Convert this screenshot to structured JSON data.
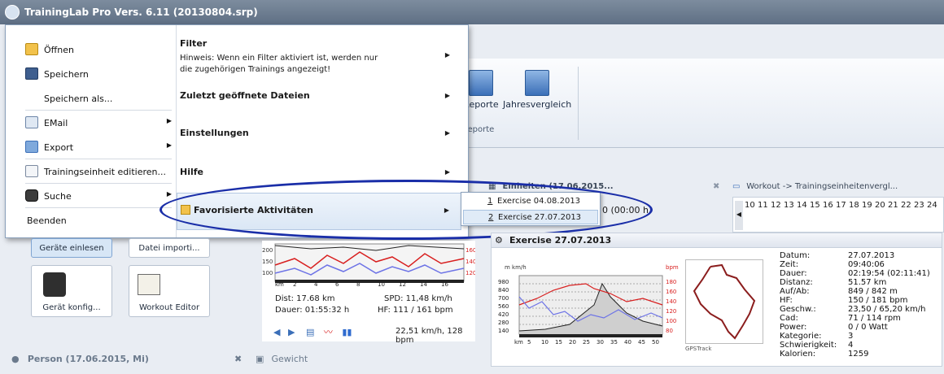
{
  "window": {
    "title": "TrainingLab Pro Vers. 6.11 (20130804.srp)"
  },
  "ribbon": {
    "buttons": [
      {
        "label": "Reporte",
        "icon": "report-icon"
      },
      {
        "label": "Jahresvergleich",
        "icon": "year-compare-icon"
      }
    ],
    "group_label": "Reporte"
  },
  "app_menu": {
    "left_items": [
      {
        "label": "Öffnen",
        "icon": "folder-open-icon",
        "has_submenu": false
      },
      {
        "label": "Speichern",
        "icon": "save-icon",
        "has_submenu": false
      },
      {
        "label": "Speichern als...",
        "icon": "",
        "has_submenu": false
      },
      {
        "label": "EMail",
        "icon": "email-icon",
        "has_submenu": true
      },
      {
        "label": "Export",
        "icon": "export-icon",
        "has_submenu": true
      },
      {
        "label": "Trainingseinheit editieren...",
        "icon": "calendar-icon",
        "has_submenu": false
      },
      {
        "label": "Suche",
        "icon": "binoculars-icon",
        "has_submenu": true
      },
      {
        "label": "Beenden",
        "icon": "",
        "has_submenu": false
      }
    ],
    "right_items": {
      "filter": {
        "title": "Filter",
        "hint": "Hinweis: Wenn ein Filter aktiviert ist, werden nur die zugehörigen Trainings angezeigt!"
      },
      "recent": {
        "title": "Zuletzt geöffnete Dateien"
      },
      "settings": {
        "title": "Einstellungen"
      },
      "help": {
        "title": "Hilfe"
      },
      "favorites": {
        "title": "Favorisierte Aktivitäten"
      }
    },
    "favorites_submenu": [
      {
        "key": "1",
        "label": "Exercise 04.08.2013"
      },
      {
        "key": "2",
        "label": "Exercise 27.07.2013"
      }
    ]
  },
  "background": {
    "info_header": "Einheiten (17.06.2015...",
    "status_value": "0 (00:00 h)",
    "calendar": {
      "header": "Workout -> Trainingseinheitenvergl...",
      "days": [
        "10",
        "11",
        "12",
        "13",
        "14",
        "15",
        "16",
        "17",
        "18",
        "19",
        "20",
        "21",
        "22",
        "23",
        "24"
      ]
    },
    "buttons": [
      {
        "label": "Geräte einlesen"
      },
      {
        "label": "Datei importi..."
      },
      {
        "label": "Gerät konfig..."
      },
      {
        "label": "Workout Editor"
      }
    ],
    "person_bar": "Person (17.06.2015, Mi)",
    "gewicht_bar": "Gewicht",
    "small_graph": {
      "dist": "Dist: 17.68 km",
      "spd": "SPD: 11,48 km/h",
      "dauer": "Dauer: 01:55:32 h",
      "hf": "HF: 111 / 161 bpm",
      "footer": "22,51 km/h, 128 bpm",
      "x_label": "km",
      "x_ticks": [
        "2",
        "4",
        "6",
        "8",
        "10",
        "12",
        "14",
        "16"
      ],
      "y_left": [
        "100",
        "150",
        "200"
      ],
      "y_right": [
        "120",
        "140",
        "160"
      ]
    },
    "exercise": {
      "title": "Exercise 27.07.2013",
      "left_unit": "m  km/h",
      "right_unit": "bpm",
      "y_left": [
        "980",
        "840",
        "700",
        "560",
        "420",
        "280",
        "140"
      ],
      "y_right": [
        "180",
        "160",
        "140",
        "120",
        "100",
        "80"
      ],
      "x_label": "km",
      "x_ticks": [
        "5",
        "10",
        "15",
        "20",
        "25",
        "30",
        "35",
        "40",
        "45",
        "50"
      ],
      "gps_label": "GPSTrack",
      "details": [
        {
          "k": "Datum:",
          "v": "27.07.2013"
        },
        {
          "k": "Zeit:",
          "v": "09:40:06"
        },
        {
          "k": "Dauer:",
          "v": "02:19:54 (02:11:41)"
        },
        {
          "k": "Distanz:",
          "v": "51.57 km"
        },
        {
          "k": "Auf/Ab:",
          "v": "849 / 842 m"
        },
        {
          "k": "HF:",
          "v": "150 / 181 bpm"
        },
        {
          "k": "Geschw.:",
          "v": "23,50 / 65,20 km/h"
        },
        {
          "k": "Cad:",
          "v": "71 / 114 rpm"
        },
        {
          "k": "Power:",
          "v": "0 / 0 Watt"
        },
        {
          "k": "Kategorie:",
          "v": "3"
        },
        {
          "k": "Schwierigkeit:",
          "v": "4"
        },
        {
          "k": "Kalorien:",
          "v": "1259"
        }
      ]
    }
  }
}
